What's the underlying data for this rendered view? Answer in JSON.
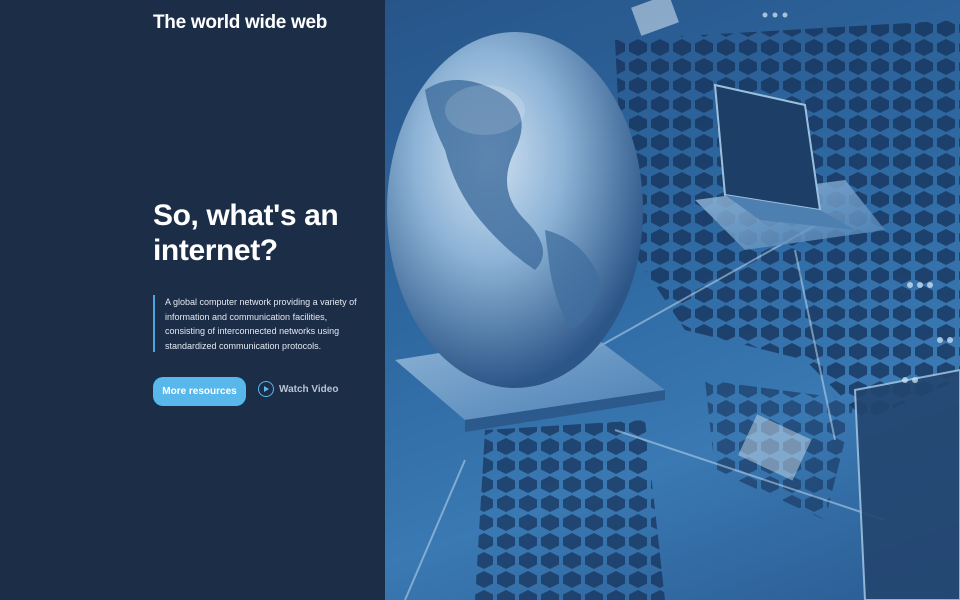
{
  "header": {
    "brand": "The world wide web"
  },
  "hero": {
    "title_line1": "So, what's an",
    "title_line2": "internet?",
    "description": "A global computer network providing a variety of information and communication facilities, consisting of interconnected networks using standardized communication protocols.",
    "primary_button": "More resources",
    "video_link": "Watch Video",
    "video_icon": "play-circle-icon"
  },
  "colors": {
    "panel_bg": "#1c2d47",
    "accent": "#58b8ec",
    "image_tint": "#2f6aa3"
  }
}
